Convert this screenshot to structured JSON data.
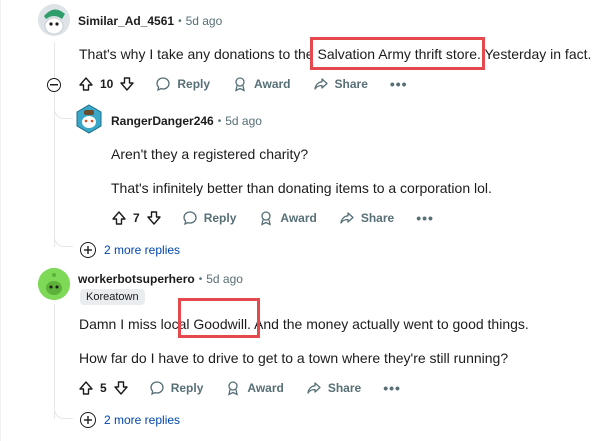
{
  "comments": [
    {
      "author": "Similar_Ad_4561",
      "time": "5d ago",
      "body": [
        "That's why I take any donations to the Salvation Army thrift store. Yesterday in fact."
      ],
      "votes": "10"
    },
    {
      "author": "RangerDanger246",
      "time": "5d ago",
      "body": [
        "Aren't they a registered charity?",
        "That's infinitely better than donating items to a corporation lol."
      ],
      "votes": "7"
    },
    {
      "author": "workerbotsuperhero",
      "time": "5d ago",
      "flair": "Koreatown",
      "body": [
        "Damn I miss local Goodwill. And the money actually went to good things.",
        "How far do I have to drive to get to a town where they're still running?"
      ],
      "votes": "5"
    }
  ],
  "actions": {
    "reply": "Reply",
    "award": "Award",
    "share": "Share",
    "more": "•••"
  },
  "more_replies_1": "2 more replies",
  "more_replies_2": "2 more replies",
  "colors": {
    "highlight": "#e5484d",
    "link": "#0045ac",
    "meta": "#576f76"
  }
}
